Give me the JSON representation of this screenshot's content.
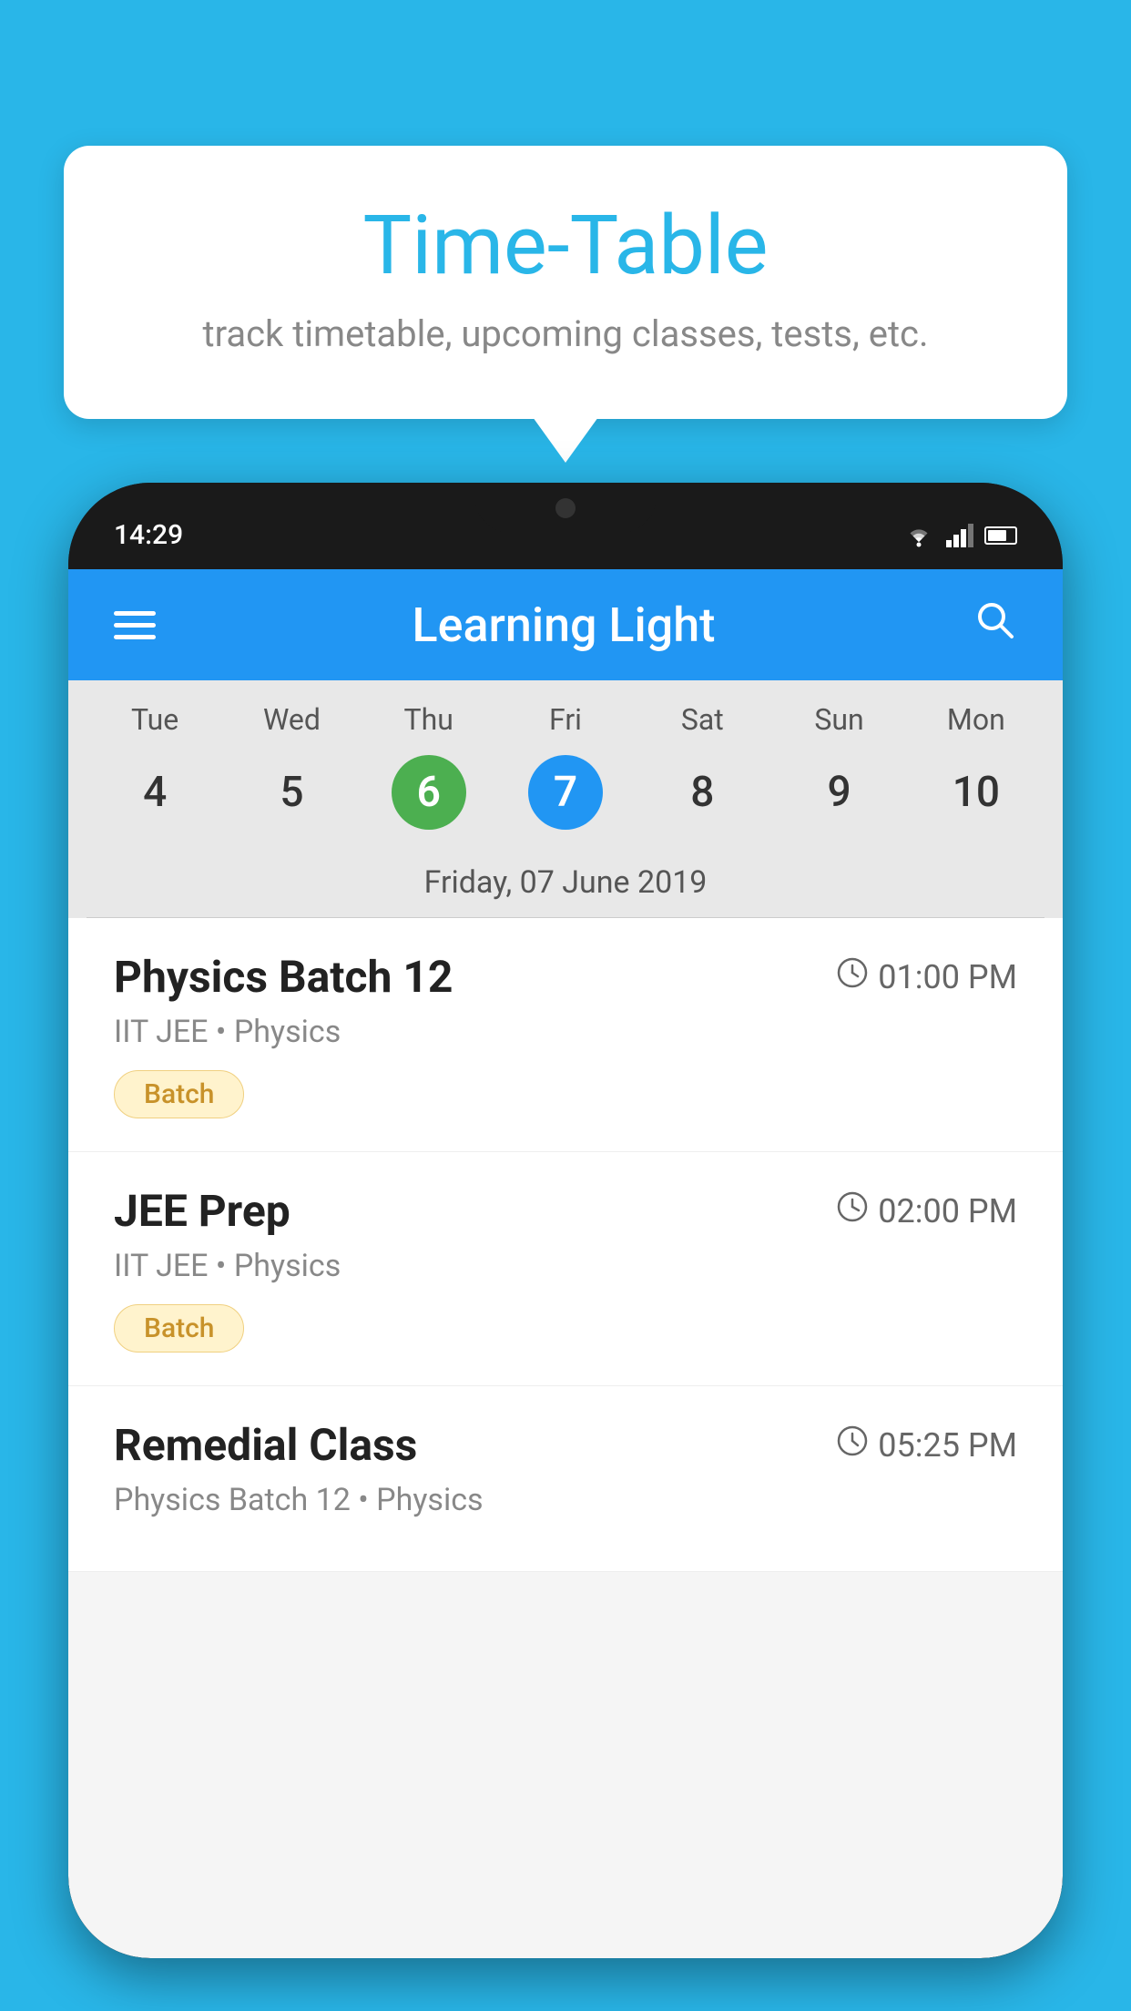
{
  "background_color": "#29b6e8",
  "tooltip": {
    "title": "Time-Table",
    "subtitle": "track timetable, upcoming classes, tests, etc."
  },
  "phone": {
    "status_bar": {
      "time": "14:29"
    },
    "header": {
      "title": "Learning Light",
      "hamburger_label": "menu",
      "search_label": "search"
    },
    "calendar": {
      "weekdays": [
        "Tue",
        "Wed",
        "Thu",
        "Fri",
        "Sat",
        "Sun",
        "Mon"
      ],
      "dates": [
        {
          "date": "4",
          "type": "normal"
        },
        {
          "date": "5",
          "type": "normal"
        },
        {
          "date": "6",
          "type": "today"
        },
        {
          "date": "7",
          "type": "selected"
        },
        {
          "date": "8",
          "type": "normal"
        },
        {
          "date": "9",
          "type": "normal"
        },
        {
          "date": "10",
          "type": "normal"
        }
      ],
      "selected_date_label": "Friday, 07 June 2019"
    },
    "schedule": [
      {
        "title": "Physics Batch 12",
        "time": "01:00 PM",
        "meta": "IIT JEE • Physics",
        "badge": "Batch"
      },
      {
        "title": "JEE Prep",
        "time": "02:00 PM",
        "meta": "IIT JEE • Physics",
        "badge": "Batch"
      },
      {
        "title": "Remedial Class",
        "time": "05:25 PM",
        "meta": "Physics Batch 12 • Physics",
        "badge": null
      }
    ]
  }
}
